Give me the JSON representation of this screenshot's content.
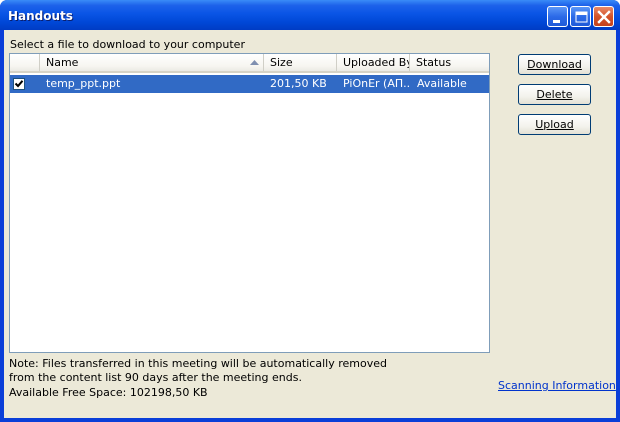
{
  "window": {
    "title": "Handouts",
    "controls": [
      "minimize-icon",
      "maximize-icon",
      "close-icon"
    ]
  },
  "instruction": "Select a file to download to your computer",
  "file_list": {
    "columns": [
      "",
      "Name",
      "Size",
      "Uploaded By",
      "Status"
    ],
    "sort_column": "Name",
    "sort_direction": "ascending",
    "rows": [
      {
        "checked": true,
        "selected": true,
        "name": "temp_ppt.ppt",
        "size": "201,50 KB",
        "uploaded_by": "PiOnEr (АП...",
        "status": "Available"
      }
    ]
  },
  "buttons": {
    "download": "Download",
    "delete": "Delete",
    "upload": "Upload"
  },
  "note": "Note: Files transferred in this meeting will be automatically removed from the content list 90 days after the meeting ends.",
  "free_space": "Available Free Space: 102198,50 KB",
  "scanning_link": "Scanning Information",
  "colors": {
    "title_bar": "#0a55e6",
    "selection": "#316ac5",
    "face": "#ece9d8",
    "link": "#0033cc",
    "close_button": "#d4532a"
  }
}
